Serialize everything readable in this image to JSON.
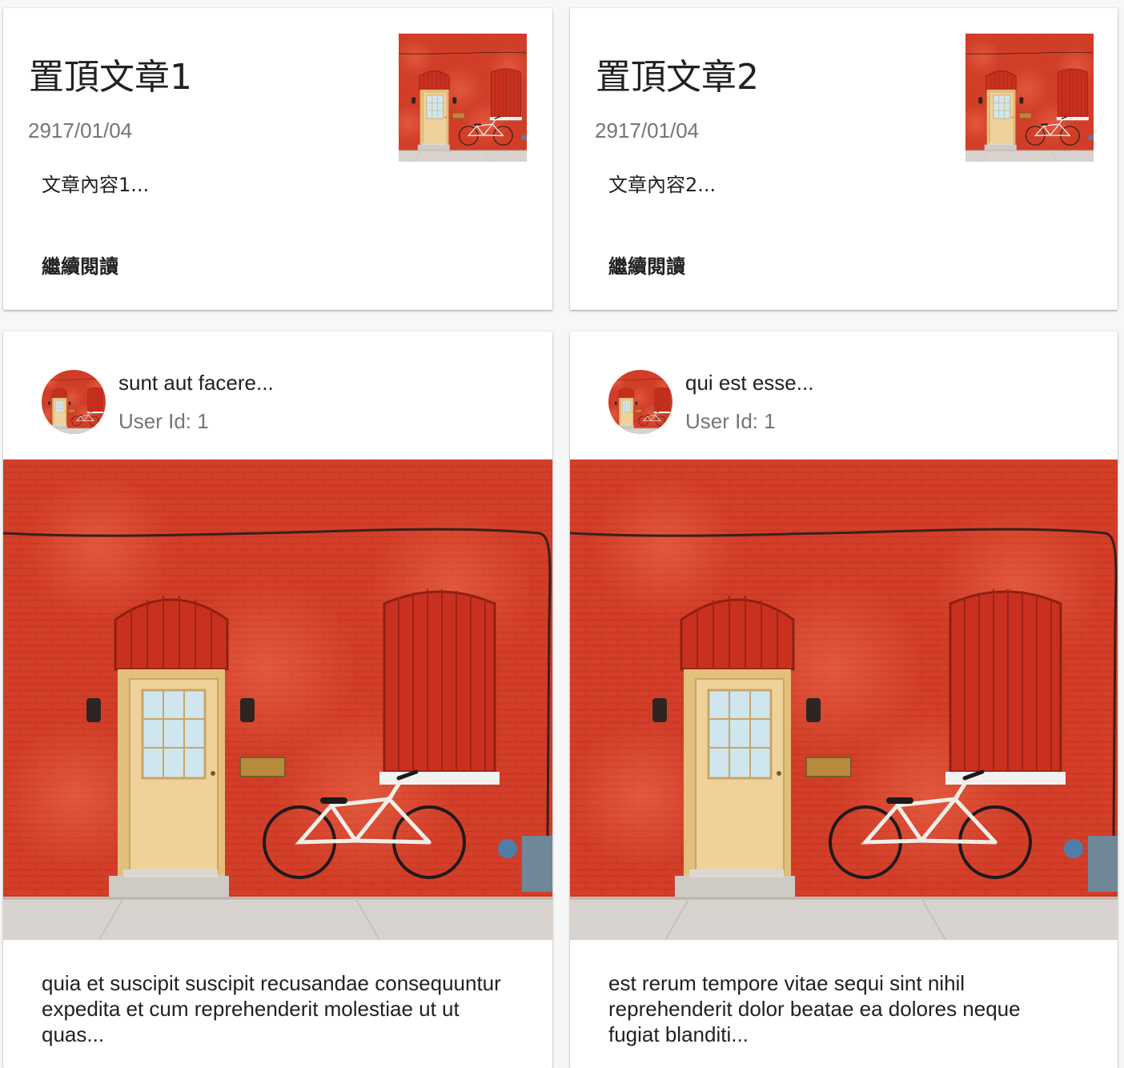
{
  "featured_posts": [
    {
      "title": "置頂文章1",
      "date": "2917/01/04",
      "excerpt": "文章內容1...",
      "read_more": "繼續閱讀",
      "thumbnail_icon": "red-brick-wall-bicycle-photo"
    },
    {
      "title": "置頂文章2",
      "date": "2917/01/04",
      "excerpt": "文章內容2...",
      "read_more": "繼續閱讀",
      "thumbnail_icon": "red-brick-wall-bicycle-photo"
    }
  ],
  "posts": [
    {
      "title": "sunt aut facere...",
      "user_line": "User Id: 1",
      "body": "quia et suscipit suscipit recusandae consequuntur expedita et cum reprehenderit molestiae ut ut quas...",
      "avatar_icon": "red-brick-wall-bicycle-photo",
      "media_icon": "red-brick-wall-bicycle-photo"
    },
    {
      "title": "qui est esse...",
      "user_line": "User Id: 1",
      "body": "est rerum tempore vitae sequi sint nihil reprehenderit dolor beatae ea dolores neque fugiat blanditi...",
      "avatar_icon": "red-brick-wall-bicycle-photo",
      "media_icon": "red-brick-wall-bicycle-photo"
    }
  ],
  "colors": {
    "brick": "#d23a26",
    "door": "#e8c98a",
    "sidewalk": "#d9d4cf"
  }
}
